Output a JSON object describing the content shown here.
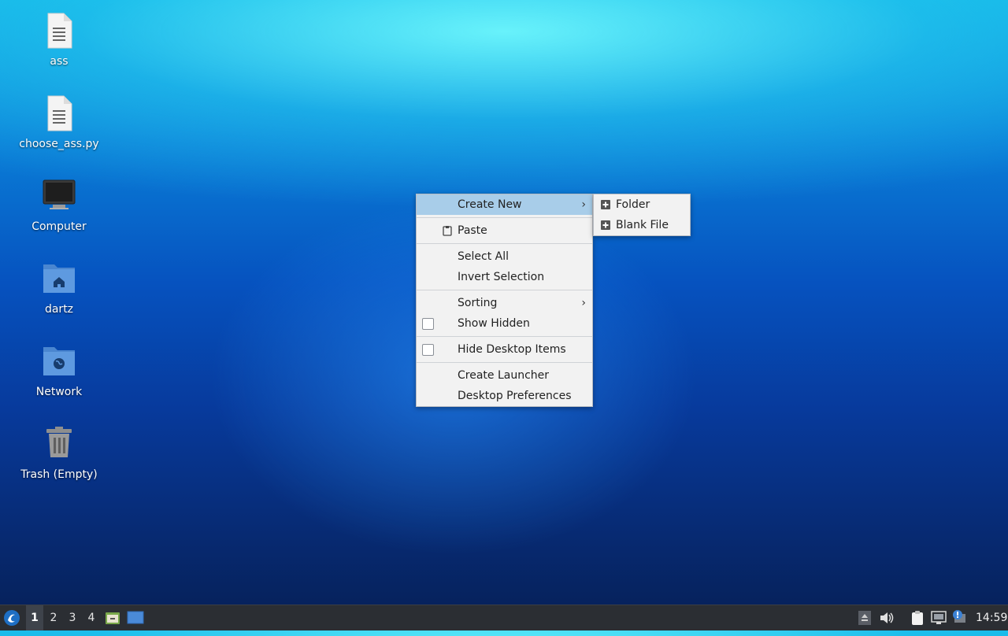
{
  "desktop": {
    "icons": [
      {
        "label": "ass",
        "icon": "text-file-icon"
      },
      {
        "label": "choose_ass.py",
        "icon": "text-file-icon"
      },
      {
        "label": "Computer",
        "icon": "computer-icon"
      },
      {
        "label": "dartz",
        "icon": "home-folder-icon"
      },
      {
        "label": "Network",
        "icon": "network-folder-icon"
      },
      {
        "label": "Trash (Empty)",
        "icon": "trash-icon"
      }
    ]
  },
  "context_menu": {
    "create_new": "Create New",
    "paste": "Paste",
    "select_all": "Select All",
    "invert_selection": "Invert Selection",
    "sorting": "Sorting",
    "show_hidden": "Show Hidden",
    "hide_desktop_items": "Hide Desktop Items",
    "create_launcher": "Create Launcher",
    "desktop_preferences": "Desktop Preferences",
    "arrow": "›"
  },
  "submenu": {
    "folder": "Folder",
    "blank_file": "Blank File"
  },
  "taskbar": {
    "workspaces": [
      "1",
      "2",
      "3",
      "4"
    ],
    "active_workspace": "1",
    "clock": "14:59"
  },
  "colors": {
    "menu_highlight": "#a8cde9",
    "taskbar_bg": "#2b2e33"
  }
}
